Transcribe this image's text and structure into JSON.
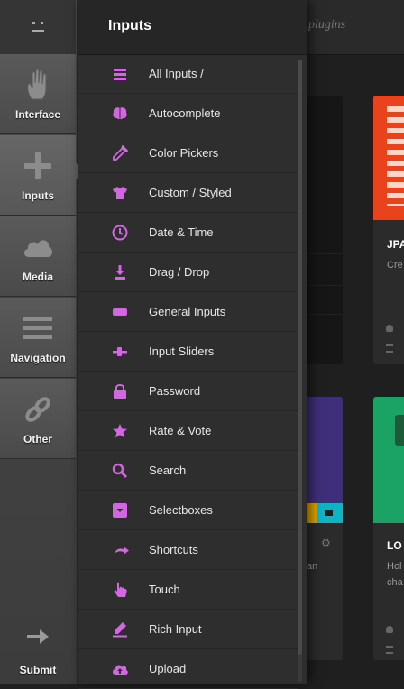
{
  "rail": {
    "items": [
      {
        "label": "Interface",
        "icon": "hand-icon"
      },
      {
        "label": "Inputs",
        "icon": "plus-icon"
      },
      {
        "label": "Media",
        "icon": "cloud-icon"
      },
      {
        "label": "Navigation",
        "icon": "menu-icon"
      },
      {
        "label": "Other",
        "icon": "link-icon"
      }
    ],
    "submit_label": "Submit"
  },
  "panel": {
    "title": "Inputs",
    "items": [
      {
        "label": "All Inputs /",
        "icon": "list-icon"
      },
      {
        "label": "Autocomplete",
        "icon": "brain-icon"
      },
      {
        "label": "Color Pickers",
        "icon": "eyedropper-icon"
      },
      {
        "label": "Custom / Styled",
        "icon": "tshirt-icon"
      },
      {
        "label": "Date & Time",
        "icon": "clock-icon"
      },
      {
        "label": "Drag / Drop",
        "icon": "download-icon"
      },
      {
        "label": "General Inputs",
        "icon": "input-field-icon"
      },
      {
        "label": "Input Sliders",
        "icon": "slider-icon"
      },
      {
        "label": "Password",
        "icon": "lock-icon"
      },
      {
        "label": "Rate & Vote",
        "icon": "star-icon"
      },
      {
        "label": "Search",
        "icon": "search-icon"
      },
      {
        "label": "Selectboxes",
        "icon": "selectbox-icon"
      },
      {
        "label": "Shortcuts",
        "icon": "shortcut-arrow-icon"
      },
      {
        "label": "Touch",
        "icon": "pointer-hand-icon"
      },
      {
        "label": "Rich Input",
        "icon": "pen-icon"
      },
      {
        "label": "Upload",
        "icon": "cloud-upload-icon"
      }
    ]
  },
  "background": {
    "topbar_text": "plugins",
    "card_right_top": {
      "title": "JPA",
      "subtitle": "Cre"
    },
    "card_right_bottom": {
      "title": "LO",
      "line1": "Hol",
      "line2": "cha"
    },
    "card_left_bottom_text": "an"
  },
  "colors": {
    "accent": "#d466e4",
    "card_orange": "#e8431d",
    "card_green": "#1aa364",
    "card_purple": "#3f2f7a"
  }
}
